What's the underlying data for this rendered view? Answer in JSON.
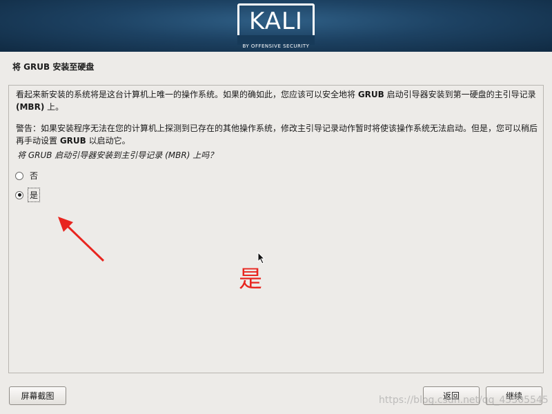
{
  "header": {
    "logo_text": "KALI",
    "logo_subtext": "BY OFFENSIVE SECURITY",
    "background_color": "#1d4263"
  },
  "page": {
    "title": "将 GRUB 安装至硬盘"
  },
  "content": {
    "paragraph1": {
      "part1": "看起来新安装的系统将是这台计算机上唯一的操作系统。如果的确如此，您应该可以安全地将 ",
      "bold1": "GRUB",
      "part2": " 启动引导器安装到第一硬盘的主引导记录",
      "bold2": "(MBR)",
      "part3": " 上。"
    },
    "paragraph2": {
      "part1": "警告：如果安装程序无法在您的计算机上探测到已存在的其他操作系统，修改主引导记录动作暂时将使该操作系统无法启动。但是，您可以稍后再手动设置 ",
      "bold1": "GRUB",
      "part2": " 以启动它。"
    },
    "question": "将 GRUB 启动引导器安装到主引导记录 (MBR) 上吗？",
    "options": [
      {
        "label": "否",
        "selected": false
      },
      {
        "label": "是",
        "selected": true
      }
    ]
  },
  "annotation": {
    "text": "是",
    "color": "#e8251f"
  },
  "buttons": {
    "screenshot": "屏幕截图",
    "back": "返回",
    "continue": "继续"
  },
  "watermark": "https://blog.csdn.net/qq_45305545"
}
